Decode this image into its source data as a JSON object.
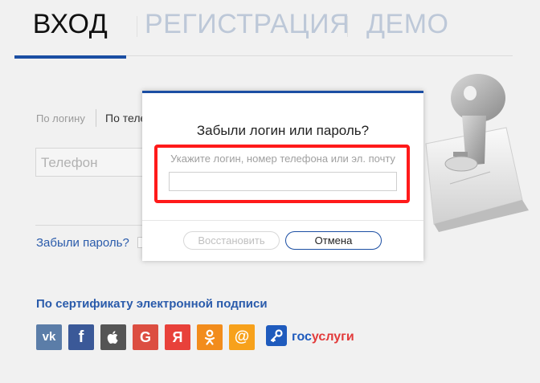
{
  "tabs": {
    "login": "ВХОД",
    "register": "РЕГИСТРАЦИЯ",
    "demo": "ДЕМО"
  },
  "login_form": {
    "by_login": "По логину",
    "by_phone": "По телефону",
    "phone_placeholder": "Телефон",
    "forgot_password": "Забыли пароль?",
    "certificate_login": "По сертификату электронной подписи"
  },
  "socials": {
    "items": [
      {
        "name": "vk",
        "label": "vk",
        "color": "#5b7da8"
      },
      {
        "name": "facebook",
        "label": "f",
        "color": "#3b5998"
      },
      {
        "name": "apple",
        "label": "",
        "color": "#555555"
      },
      {
        "name": "google",
        "label": "G",
        "color": "#dc4e41"
      },
      {
        "name": "yandex",
        "label": "Я",
        "color": "#e8413a"
      },
      {
        "name": "odnoklassniki",
        "label": "",
        "color": "#f28c1c"
      },
      {
        "name": "mailru",
        "label": "@",
        "color": "#f7a11b"
      }
    ],
    "gosuslugi_a": "гос",
    "gosuslugi_b": "услуги"
  },
  "modal": {
    "title": "Забыли логин или пароль?",
    "input_label": "Укажите логин, номер телефона или эл. почту",
    "input_value": "",
    "restore_button": "Восстановить",
    "cancel_button": "Отмена"
  },
  "colors": {
    "accent": "#1b4ea3",
    "link": "#2a5bab",
    "highlight": "#ff1a1a"
  }
}
